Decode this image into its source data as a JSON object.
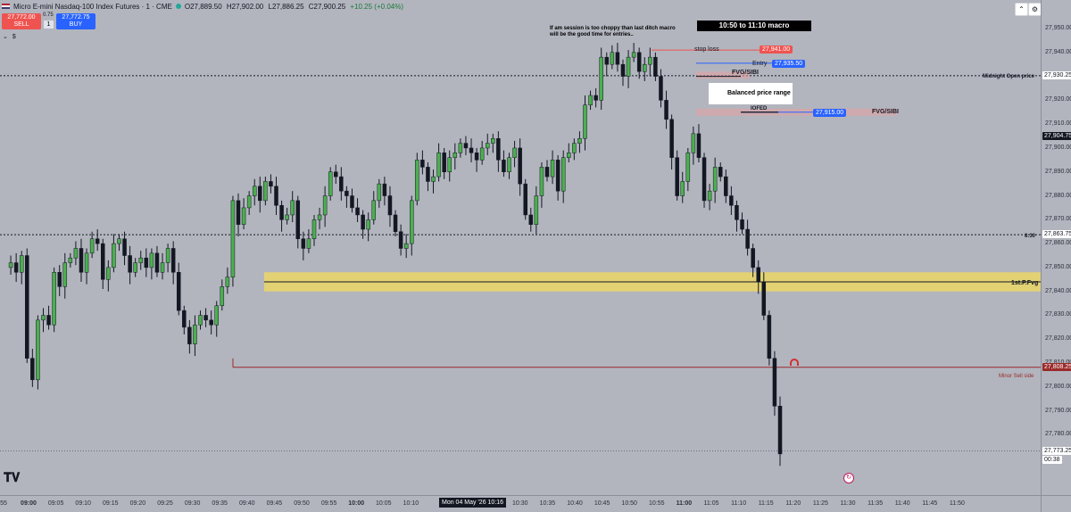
{
  "header": {
    "symbol_title": "Micro E-mini Nasdaq-100 Index Futures · 1 · CME",
    "ohlc": {
      "open": "O27,889.50",
      "high": "H27,902.00",
      "low": "L27,886.25",
      "close": "C27,900.25",
      "change": "+10.25 (+0.04%)"
    },
    "sell_price": "27,772.00",
    "sell_label": "SELL",
    "spread": "0.75",
    "quantity": "1",
    "buy_price": "27,772.75",
    "buy_label": "BUY",
    "currency": "$"
  },
  "annotations": {
    "macro_title": "10:50 to 11:10 macro",
    "note_line1": "If am session is too choppy than last ditch macro",
    "note_line2": "will be the good time for entries..",
    "stop_loss_label": "stop loss",
    "stop_loss_price": "27,941.00",
    "entry_label": "Entry",
    "entry_price": "27,935.50",
    "fvg_sibi_top": "FVG/SIBI",
    "balanced_range": "Balanced price range",
    "iofed": "IOFED",
    "fvg_sibi_right": "FVG/SIBI",
    "order_price": "27,915.00",
    "midnight_open": "Midnight Open price",
    "time_830": "8:30",
    "first_pfvg": "1st.P.Fvg",
    "minor_sell_side": "Minor Sell side"
  },
  "price_axis": {
    "ticks": [
      "27,950.00",
      "27,940.00",
      "27,930.00",
      "27,920.00",
      "27,910.00",
      "27,900.00",
      "27,890.00",
      "27,880.00",
      "27,870.00",
      "27,860.00",
      "27,850.00",
      "27,840.00",
      "27,830.00",
      "27,820.00",
      "27,810.00",
      "27,800.00",
      "27,790.00",
      "27,780.00"
    ],
    "markers": {
      "midnight_open": "27,930.25",
      "crosshair": "27,904.75",
      "level_830": "27,863.75",
      "minor_sell_side": "27,808.25",
      "last_price": "27,773.25",
      "countdown": "00:38"
    }
  },
  "time_axis": {
    "ticks": [
      "55",
      "09:00",
      "09:05",
      "09:10",
      "09:15",
      "09:20",
      "09:25",
      "09:30",
      "09:35",
      "09:40",
      "09:45",
      "09:50",
      "09:55",
      "10:00",
      "10:05",
      "10:10",
      "10:15",
      "10:20",
      "10:25",
      "10:30",
      "10:35",
      "10:40",
      "10:45",
      "10:50",
      "10:55",
      "11:00",
      "11:05",
      "11:10",
      "11:15",
      "11:20",
      "11:25",
      "11:30",
      "11:35",
      "11:40",
      "11:45",
      "11:50"
    ],
    "cursor_label": "Mon 04 May '26   10:16"
  },
  "colors": {
    "background": "#b2b5be",
    "bull": "#4caf50",
    "bear": "#131722",
    "sell": "#ef5350",
    "buy": "#2962ff",
    "fvg_zone": "#ecd96b",
    "sell_side_line": "#9b2a2a"
  },
  "icons": [
    "tradingview-logo-icon",
    "flag-icon",
    "eye-icon",
    "download-icon",
    "collapse-icon",
    "settings-icon",
    "alert-magnet-icon",
    "replay-icon"
  ]
}
